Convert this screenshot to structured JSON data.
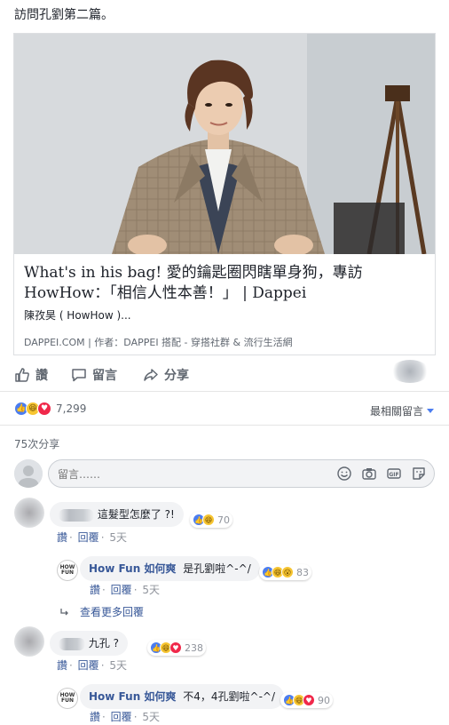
{
  "post": {
    "text": "訪問孔劉第二篇。"
  },
  "link_card": {
    "title": "What's in his bag! 愛的鑰匙圈閃瞎單身狗，專訪 HowHow：「相信人性本善！」 | Dappei",
    "description": "陳孜昊 ( HowHow )...",
    "domain": "DAPPEI.COM",
    "author_prefix": "作者：",
    "author": "DAPPEI 搭配 - 穿搭社群 & 流行生活網"
  },
  "actions": {
    "like": "讚",
    "comment": "留言",
    "share": "分享"
  },
  "reactions": {
    "count": "7,299",
    "sort_label": "最相關留言"
  },
  "shares": {
    "count_label": "75次分享"
  },
  "composer": {
    "placeholder": "留言……"
  },
  "comments": [
    {
      "text": "這髮型怎麼了 ?!",
      "reaction_count": "70",
      "like": "讚",
      "reply": "回覆",
      "time": "5天",
      "replies": [
        {
          "name": "How Fun 如何爽",
          "text": "是孔劉啦^-^/",
          "reaction_count": "83",
          "like": "讚",
          "reply": "回覆",
          "time": "5天"
        }
      ],
      "more_replies": "查看更多回覆"
    },
    {
      "text": "九孔 ?",
      "reaction_count": "238",
      "like": "讚",
      "reply": "回覆",
      "time": "5天",
      "replies": [
        {
          "name": "How Fun 如何爽",
          "text": "不4，4孔劉啦^-^/",
          "reaction_count": "90",
          "like": "讚",
          "reply": "回覆",
          "time": "5天"
        }
      ]
    }
  ],
  "icons": {
    "like": "thumbs-up-icon",
    "comment": "speech-bubble-icon",
    "share": "share-arrow-icon",
    "emoji": "emoji-icon",
    "camera": "camera-icon",
    "gif": "gif-icon",
    "sticker": "sticker-icon"
  },
  "colors": {
    "link_blue": "#385898",
    "like_blue": "#4b7df0",
    "love_red": "#f0284a",
    "haha_yellow": "#f7c531"
  }
}
